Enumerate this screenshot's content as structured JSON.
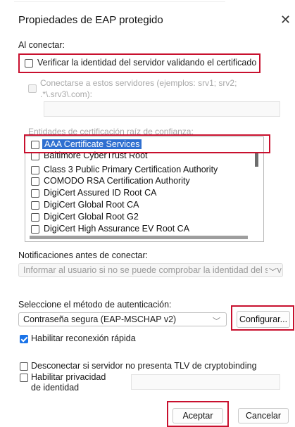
{
  "window": {
    "title": "Propiedades de EAP protegido",
    "close_glyph": "✕"
  },
  "connect": {
    "heading": "Al conectar:",
    "verify_server_label": "Verificar la identidad del servidor validando el certificado",
    "connect_servers_label": "Conectarse a estos servidores (ejemplos: srv1; srv2;",
    "connect_servers_label2": ".*\\.srv3\\.com):"
  },
  "ca": {
    "heading": "Entidades de certificación raíz de confianza:",
    "items": [
      "AAA Certificate Services",
      "Baltimore CyberTrust Root",
      "Class 3 Public Primary Certification Authority",
      "COMODO RSA Certification Authority",
      "DigiCert Assured ID Root CA",
      "DigiCert Global Root CA",
      "DigiCert Global Root G2",
      "DigiCert High Assurance EV Root CA"
    ]
  },
  "notifications": {
    "heading": "Notificaciones antes de conectar:",
    "selected": "Informar al usuario si no se puede comprobar la identidad del serv"
  },
  "auth": {
    "heading": "Seleccione el método de autenticación:",
    "selected": "Contraseña segura (EAP-MSCHAP v2)",
    "configure_label": "Configurar..."
  },
  "options": {
    "fast_reconnect_label": "Habilitar reconexión rápida",
    "fast_reconnect_checked": true,
    "cryptobinding_label": "Desconectar si servidor no presenta TLV de cryptobinding",
    "privacy_label_1": "Habilitar privacidad",
    "privacy_label_2": "de identidad"
  },
  "footer": {
    "ok_label": "Aceptar",
    "cancel_label": "Cancelar"
  },
  "colors": {
    "highlight_box": "#c8102e",
    "selection": "#2f6fd0",
    "checkbox_on": "#1a73e8"
  }
}
